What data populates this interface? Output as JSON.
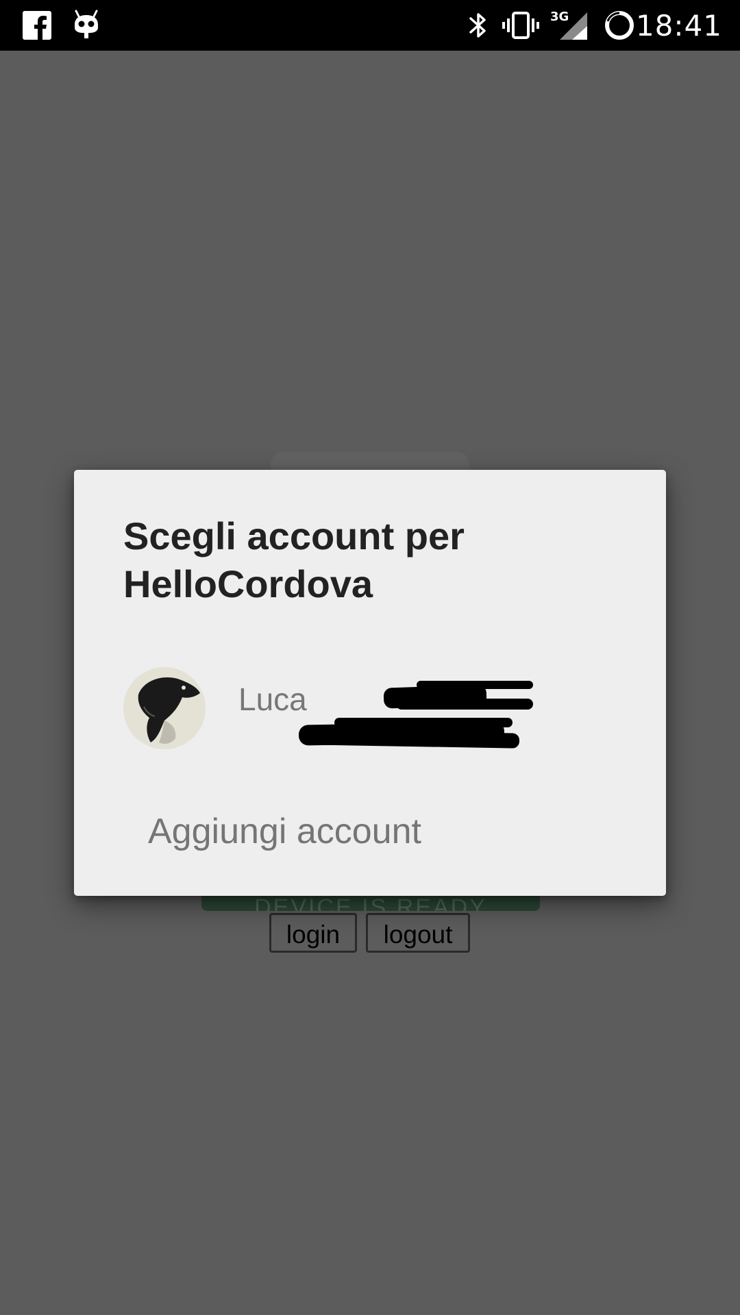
{
  "status_bar": {
    "time": "18:41",
    "left_icons": [
      "facebook-icon",
      "cyanogen-mascot-icon"
    ],
    "right_icons": [
      "bluetooth-icon",
      "vibrate-icon",
      "signal-3g-icon",
      "sync-ring-icon"
    ],
    "network_label": "3G"
  },
  "background_app": {
    "status_banner": "DEVICE IS READY",
    "login_label": "login",
    "logout_label": "logout",
    "banner_color": "#2c4735"
  },
  "dialog": {
    "title": "Scegli account per HelloCordova",
    "account": {
      "name": "Luca"
    },
    "add_account_label": "Aggiungi account"
  },
  "colors": {
    "scrim": "#5c5c5c",
    "dialog_bg": "#eeeeee",
    "title_text": "#222222",
    "secondary_text": "#757575"
  }
}
